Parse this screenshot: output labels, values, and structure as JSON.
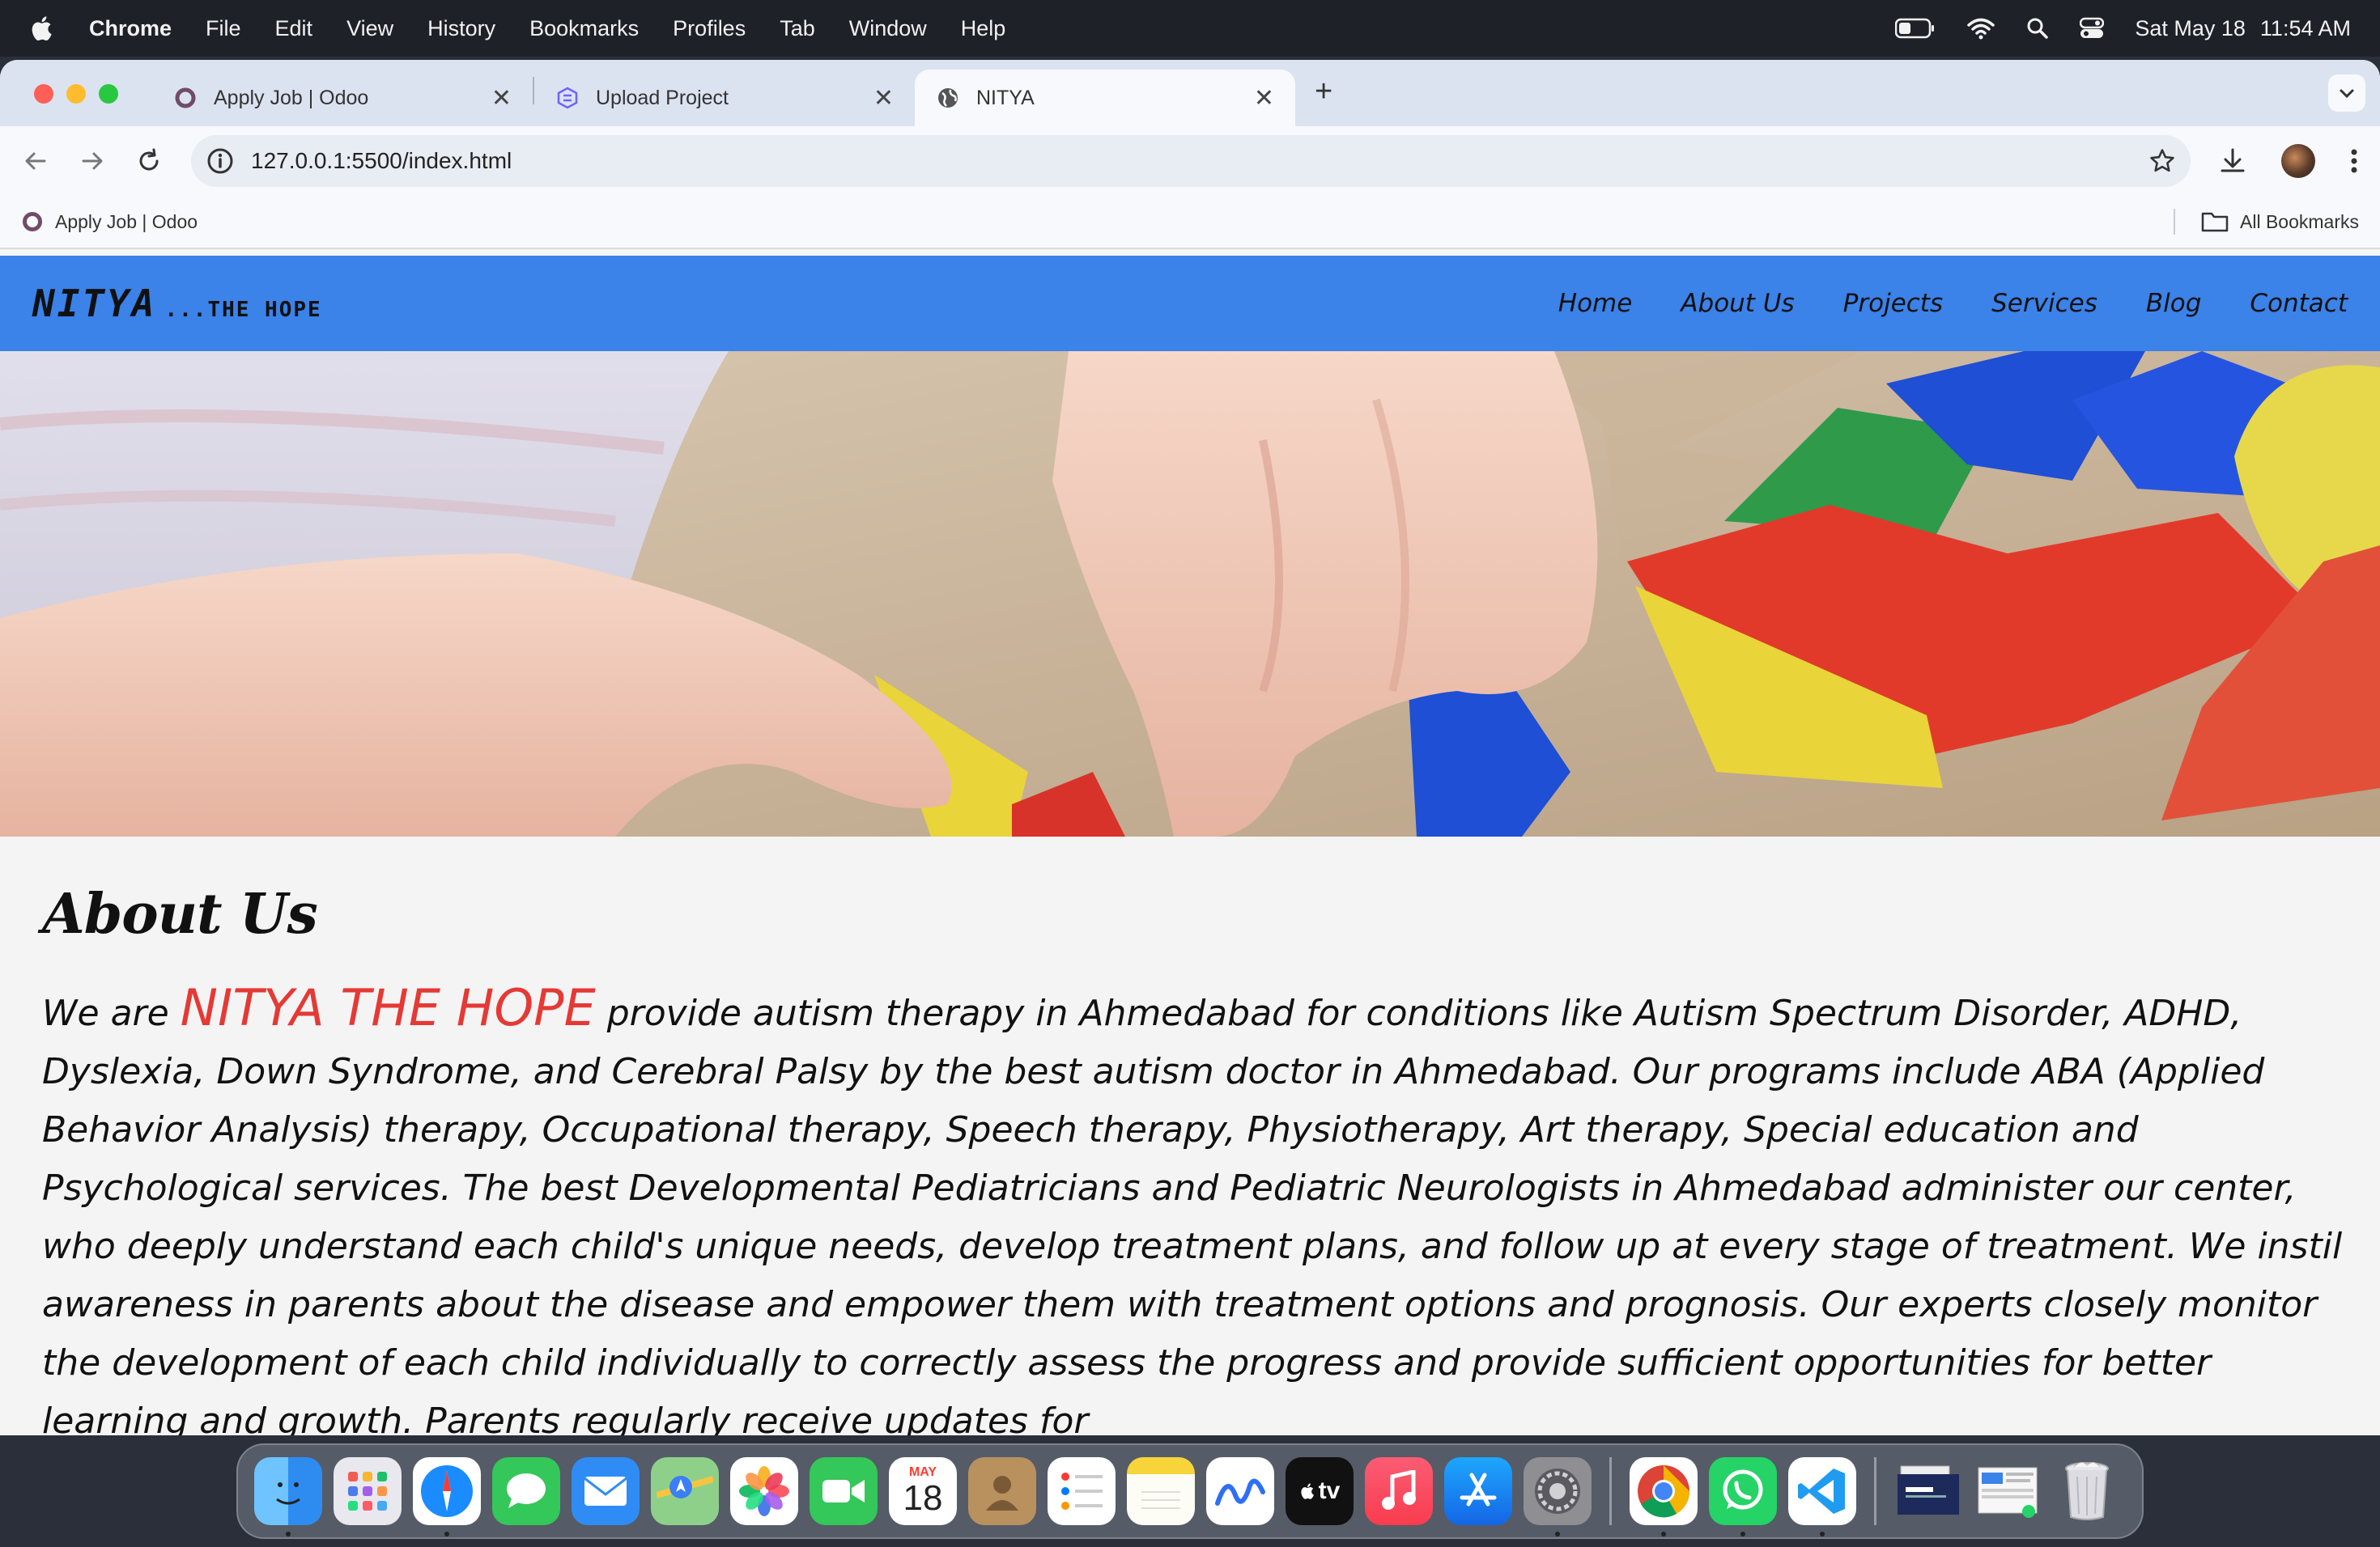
{
  "menubar": {
    "app": "Chrome",
    "items": [
      "File",
      "Edit",
      "View",
      "History",
      "Bookmarks",
      "Profiles",
      "Tab",
      "Window",
      "Help"
    ],
    "date": "Sat May 18",
    "time": "11:54 AM"
  },
  "browser": {
    "tabs": [
      {
        "title": "Apply Job | Odoo",
        "icon": "odoo-icon"
      },
      {
        "title": "Upload Project",
        "icon": "upload-project-icon"
      },
      {
        "title": "NITYA",
        "icon": "globe-icon",
        "active": true
      }
    ],
    "url": "127.0.0.1:5500/index.html",
    "bookmarks": {
      "item": "Apply Job | Odoo",
      "all_bookmarks": "All Bookmarks"
    }
  },
  "site": {
    "brand_name": "NITYA",
    "brand_tag": "...THE HOPE",
    "nav": [
      "Home",
      "About Us",
      "Projects",
      "Services",
      "Blog",
      "Contact"
    ],
    "colors": {
      "nav_bg": "#3b82e9",
      "highlight": "#e53935"
    }
  },
  "about": {
    "heading": "About Us",
    "intro_prefix": "We are ",
    "highlight": "NITYA THE HOPE",
    "body": " provide autism therapy in Ahmedabad for conditions like Autism Spectrum Disorder, ADHD, Dyslexia, Down Syndrome, and Cerebral Palsy by the best autism doctor in Ahmedabad. Our programs include ABA (Applied Behavior Analysis) therapy, Occupational therapy, Speech therapy, Physiotherapy, Art therapy, Special education and Psychological services. The best Developmental Pediatricians and Pediatric Neurologists in Ahmedabad administer our center, who deeply understand each child's unique needs, develop treatment plans, and follow up at every stage of treatment. We instil awareness in parents about the disease and empower them with treatment options and prognosis. Our experts closely monitor the development of each child individually to correctly assess the progress and provide sufficient opportunities for better learning and growth. Parents regularly receive updates for"
  },
  "dock": {
    "calendar_month": "MAY",
    "calendar_day": "18",
    "tv_label": "tv",
    "apps": [
      "finder-icon",
      "launchpad-icon",
      "safari-icon",
      "messages-icon",
      "mail-icon",
      "maps-icon",
      "photos-icon",
      "facetime-icon",
      "calendar-icon",
      "contacts-icon",
      "reminders-icon",
      "notes-icon",
      "freeform-icon",
      "apple-tv-icon",
      "music-icon",
      "app-store-icon",
      "system-settings-icon",
      "chrome-icon",
      "whatsapp-icon",
      "vscode-icon",
      "downloads-stack-icon",
      "screenshots-stack-icon",
      "trash-icon"
    ]
  }
}
